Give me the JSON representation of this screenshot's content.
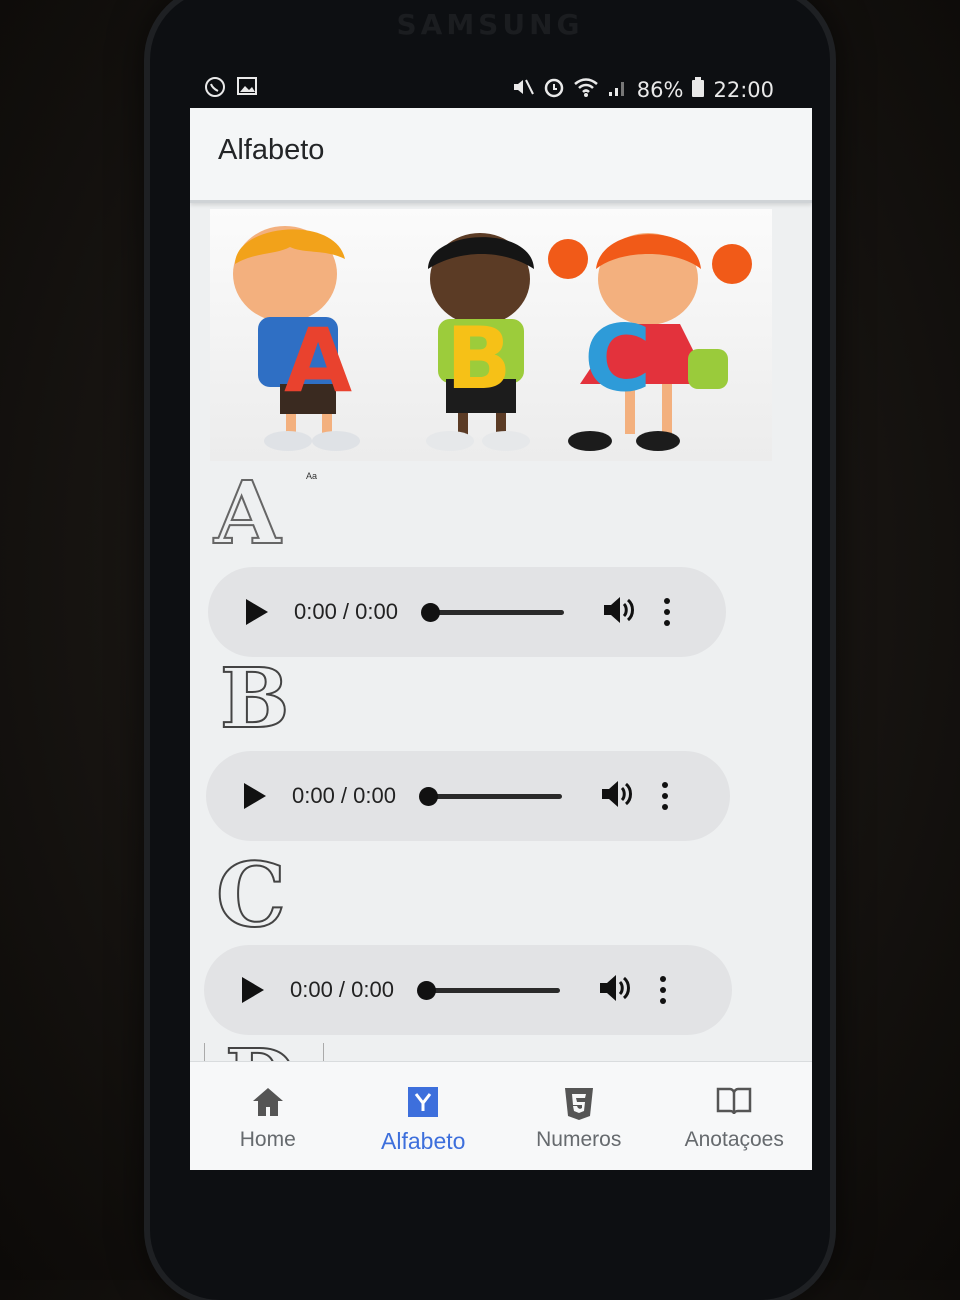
{
  "device": {
    "brand": "SAMSUNG"
  },
  "status_bar": {
    "battery": "86%",
    "time": "22:00"
  },
  "app_bar": {
    "title": "Alfabeto"
  },
  "hero": {
    "letters": [
      "A",
      "B",
      "C"
    ]
  },
  "letter_cards": [
    {
      "letter": "A",
      "note": "Aa",
      "audio": {
        "time": "0:00 / 0:00"
      }
    },
    {
      "letter": "B",
      "audio": {
        "time": "0:00 / 0:00"
      }
    },
    {
      "letter": "C",
      "audio": {
        "time": "0:00 / 0:00"
      }
    },
    {
      "letter": "D"
    }
  ],
  "tabs": [
    {
      "label": "Home",
      "icon": "home-icon",
      "active": false
    },
    {
      "label": "Alfabeto",
      "icon": "y-badge-icon",
      "active": true
    },
    {
      "label": "Numeros",
      "icon": "html5-icon",
      "active": false
    },
    {
      "label": "Anotaçoes",
      "icon": "open-book-icon",
      "active": false
    }
  ],
  "colors": {
    "accent": "#3d6fdc",
    "tab_inactive": "#666a6e",
    "audio_bg": "#e2e3e5"
  }
}
